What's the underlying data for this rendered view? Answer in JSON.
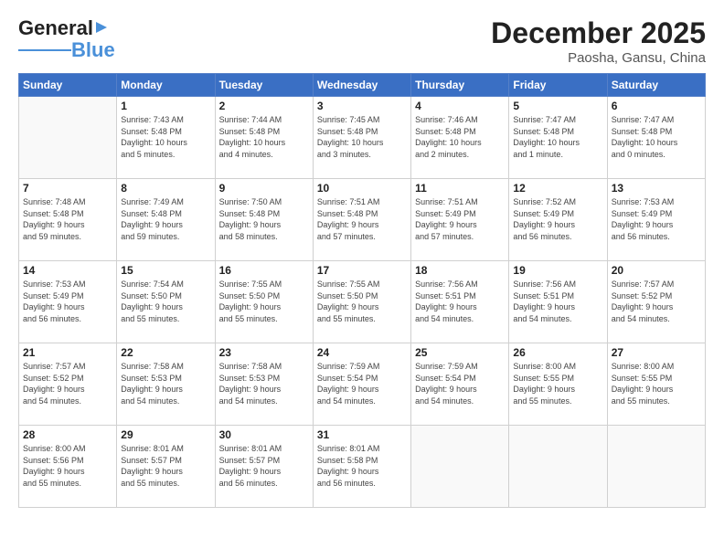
{
  "header": {
    "logo_general": "General",
    "logo_blue": "Blue",
    "month": "December 2025",
    "location": "Paosha, Gansu, China"
  },
  "weekdays": [
    "Sunday",
    "Monday",
    "Tuesday",
    "Wednesday",
    "Thursday",
    "Friday",
    "Saturday"
  ],
  "weeks": [
    [
      {
        "day": "",
        "info": ""
      },
      {
        "day": "1",
        "info": "Sunrise: 7:43 AM\nSunset: 5:48 PM\nDaylight: 10 hours\nand 5 minutes."
      },
      {
        "day": "2",
        "info": "Sunrise: 7:44 AM\nSunset: 5:48 PM\nDaylight: 10 hours\nand 4 minutes."
      },
      {
        "day": "3",
        "info": "Sunrise: 7:45 AM\nSunset: 5:48 PM\nDaylight: 10 hours\nand 3 minutes."
      },
      {
        "day": "4",
        "info": "Sunrise: 7:46 AM\nSunset: 5:48 PM\nDaylight: 10 hours\nand 2 minutes."
      },
      {
        "day": "5",
        "info": "Sunrise: 7:47 AM\nSunset: 5:48 PM\nDaylight: 10 hours\nand 1 minute."
      },
      {
        "day": "6",
        "info": "Sunrise: 7:47 AM\nSunset: 5:48 PM\nDaylight: 10 hours\nand 0 minutes."
      }
    ],
    [
      {
        "day": "7",
        "info": "Sunrise: 7:48 AM\nSunset: 5:48 PM\nDaylight: 9 hours\nand 59 minutes."
      },
      {
        "day": "8",
        "info": "Sunrise: 7:49 AM\nSunset: 5:48 PM\nDaylight: 9 hours\nand 59 minutes."
      },
      {
        "day": "9",
        "info": "Sunrise: 7:50 AM\nSunset: 5:48 PM\nDaylight: 9 hours\nand 58 minutes."
      },
      {
        "day": "10",
        "info": "Sunrise: 7:51 AM\nSunset: 5:48 PM\nDaylight: 9 hours\nand 57 minutes."
      },
      {
        "day": "11",
        "info": "Sunrise: 7:51 AM\nSunset: 5:49 PM\nDaylight: 9 hours\nand 57 minutes."
      },
      {
        "day": "12",
        "info": "Sunrise: 7:52 AM\nSunset: 5:49 PM\nDaylight: 9 hours\nand 56 minutes."
      },
      {
        "day": "13",
        "info": "Sunrise: 7:53 AM\nSunset: 5:49 PM\nDaylight: 9 hours\nand 56 minutes."
      }
    ],
    [
      {
        "day": "14",
        "info": "Sunrise: 7:53 AM\nSunset: 5:49 PM\nDaylight: 9 hours\nand 56 minutes."
      },
      {
        "day": "15",
        "info": "Sunrise: 7:54 AM\nSunset: 5:50 PM\nDaylight: 9 hours\nand 55 minutes."
      },
      {
        "day": "16",
        "info": "Sunrise: 7:55 AM\nSunset: 5:50 PM\nDaylight: 9 hours\nand 55 minutes."
      },
      {
        "day": "17",
        "info": "Sunrise: 7:55 AM\nSunset: 5:50 PM\nDaylight: 9 hours\nand 55 minutes."
      },
      {
        "day": "18",
        "info": "Sunrise: 7:56 AM\nSunset: 5:51 PM\nDaylight: 9 hours\nand 54 minutes."
      },
      {
        "day": "19",
        "info": "Sunrise: 7:56 AM\nSunset: 5:51 PM\nDaylight: 9 hours\nand 54 minutes."
      },
      {
        "day": "20",
        "info": "Sunrise: 7:57 AM\nSunset: 5:52 PM\nDaylight: 9 hours\nand 54 minutes."
      }
    ],
    [
      {
        "day": "21",
        "info": "Sunrise: 7:57 AM\nSunset: 5:52 PM\nDaylight: 9 hours\nand 54 minutes."
      },
      {
        "day": "22",
        "info": "Sunrise: 7:58 AM\nSunset: 5:53 PM\nDaylight: 9 hours\nand 54 minutes."
      },
      {
        "day": "23",
        "info": "Sunrise: 7:58 AM\nSunset: 5:53 PM\nDaylight: 9 hours\nand 54 minutes."
      },
      {
        "day": "24",
        "info": "Sunrise: 7:59 AM\nSunset: 5:54 PM\nDaylight: 9 hours\nand 54 minutes."
      },
      {
        "day": "25",
        "info": "Sunrise: 7:59 AM\nSunset: 5:54 PM\nDaylight: 9 hours\nand 54 minutes."
      },
      {
        "day": "26",
        "info": "Sunrise: 8:00 AM\nSunset: 5:55 PM\nDaylight: 9 hours\nand 55 minutes."
      },
      {
        "day": "27",
        "info": "Sunrise: 8:00 AM\nSunset: 5:55 PM\nDaylight: 9 hours\nand 55 minutes."
      }
    ],
    [
      {
        "day": "28",
        "info": "Sunrise: 8:00 AM\nSunset: 5:56 PM\nDaylight: 9 hours\nand 55 minutes."
      },
      {
        "day": "29",
        "info": "Sunrise: 8:01 AM\nSunset: 5:57 PM\nDaylight: 9 hours\nand 55 minutes."
      },
      {
        "day": "30",
        "info": "Sunrise: 8:01 AM\nSunset: 5:57 PM\nDaylight: 9 hours\nand 56 minutes."
      },
      {
        "day": "31",
        "info": "Sunrise: 8:01 AM\nSunset: 5:58 PM\nDaylight: 9 hours\nand 56 minutes."
      },
      {
        "day": "",
        "info": ""
      },
      {
        "day": "",
        "info": ""
      },
      {
        "day": "",
        "info": ""
      }
    ]
  ]
}
